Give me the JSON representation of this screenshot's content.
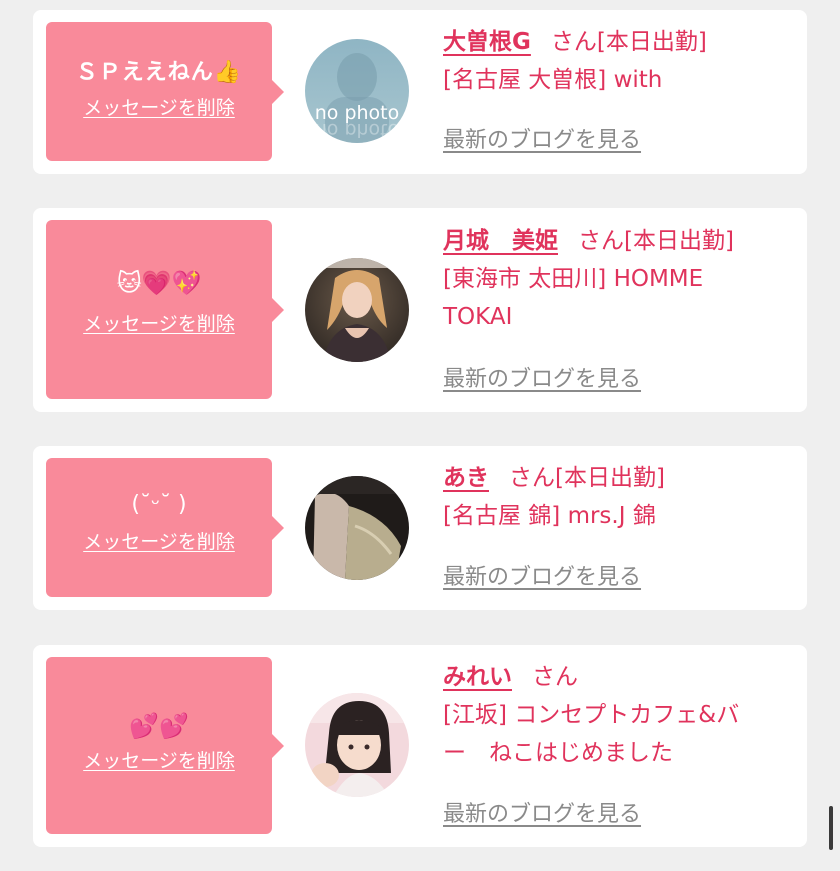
{
  "colors": {
    "page_bg": "#efefef",
    "card_bg": "#ffffff",
    "bubble_bg": "#f98a9a",
    "name_color": "#e0335c",
    "blog_link_color": "#8a8a8a"
  },
  "messages": [
    {
      "message": "ＳＰええねん👍",
      "delete_label": "メッセージを削除",
      "avatar": "no-photo",
      "avatar_text": "no photo",
      "name": "大曽根G",
      "honorific": "さん[本日出勤]",
      "shop_lines": [
        "[名古屋 大曽根] with"
      ],
      "blog_label": "最新のブログを見る"
    },
    {
      "message": "🐱💗💖",
      "delete_label": "メッセージを削除",
      "avatar": "photo",
      "name": "月城　美姫",
      "honorific": "さん[本日出勤]",
      "shop_lines": [
        "[東海市 太田川] HOMME",
        "TOKAI"
      ],
      "blog_label": "最新のブログを見る"
    },
    {
      "message": "(˘ᵕ˘ )",
      "delete_label": "メッセージを削除",
      "avatar": "photo",
      "name": "あき",
      "honorific": "さん[本日出勤]",
      "shop_lines": [
        "[名古屋 錦] mrs.J 錦"
      ],
      "blog_label": "最新のブログを見る"
    },
    {
      "message": "💕💕",
      "delete_label": "メッセージを削除",
      "avatar": "photo",
      "name": "みれい",
      "honorific": "さん",
      "shop_lines": [
        "[江坂] コンセプトカフェ&バ",
        "ー　ねこはじめました"
      ],
      "blog_label": "最新のブログを見る"
    }
  ]
}
